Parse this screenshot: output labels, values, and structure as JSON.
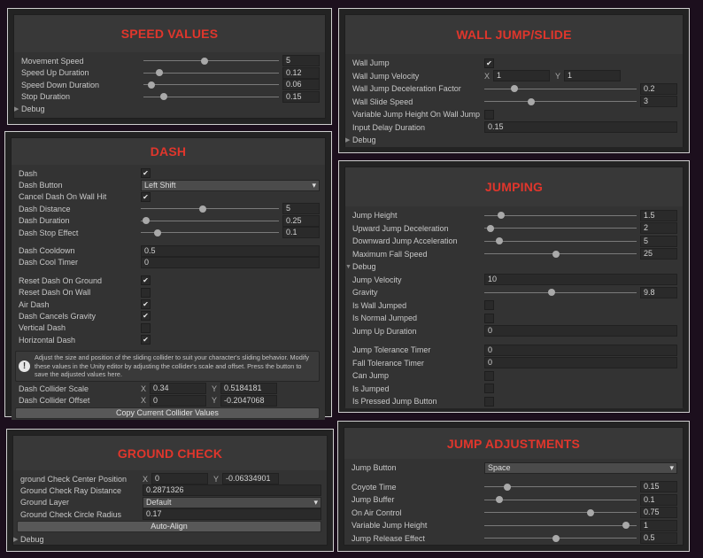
{
  "panels": {
    "speed": {
      "title": "SPEED VALUES",
      "groups": [
        [
          {
            "type": "slider",
            "label": "Movement Speed",
            "value": "5",
            "fraction": 0.45
          },
          {
            "type": "slider",
            "label": "Speed Up Duration",
            "value": "0.12",
            "fraction": 0.12
          },
          {
            "type": "slider",
            "label": "Speed Down Duration",
            "value": "0.06",
            "fraction": 0.06
          },
          {
            "type": "slider",
            "label": "Stop Duration",
            "value": "0.15",
            "fraction": 0.15
          },
          {
            "type": "foldout",
            "label": "Debug"
          }
        ]
      ]
    },
    "wall": {
      "title": "WALL JUMP/SLIDE",
      "groups": [
        [
          {
            "type": "check",
            "label": "Wall Jump",
            "checked": true
          },
          {
            "type": "vec2",
            "label": "Wall Jump Velocity",
            "x_label": "X",
            "x": "1",
            "y_label": "Y",
            "y": "1"
          },
          {
            "type": "slider",
            "label": "Wall Jump Deceleration Factor",
            "value": "0.2",
            "fraction": 0.2
          },
          {
            "type": "slider",
            "label": "Wall Slide Speed",
            "value": "3",
            "fraction": 0.31
          },
          {
            "type": "check",
            "label": "Variable Jump Height On Wall Jump",
            "checked": false
          },
          {
            "type": "float",
            "label": "Input Delay Duration",
            "value": "0.15"
          },
          {
            "type": "foldout",
            "label": "Debug"
          }
        ]
      ]
    },
    "dash": {
      "title": "DASH",
      "groups": [
        [
          {
            "type": "check",
            "label": "Dash",
            "checked": true
          },
          {
            "type": "dropdown",
            "label": "Dash Button",
            "value": "Left Shift"
          },
          {
            "type": "check",
            "label": "Cancel Dash On Wall Hit",
            "checked": true
          },
          {
            "type": "slider",
            "label": "Dash Distance",
            "value": "5",
            "fraction": 0.45
          },
          {
            "type": "slider",
            "label": "Dash Duration",
            "value": "0.25",
            "fraction": 0.04
          },
          {
            "type": "slider",
            "label": "Dash Stop Effect",
            "value": "0.1",
            "fraction": 0.12
          }
        ],
        [
          {
            "type": "float",
            "label": "Dash Cooldown",
            "value": "0.5"
          },
          {
            "type": "float",
            "label": "Dash Cool Timer",
            "value": "0"
          }
        ],
        [
          {
            "type": "check",
            "label": "Reset Dash On Ground",
            "checked": true
          },
          {
            "type": "check",
            "label": "Reset Dash On Wall",
            "checked": false
          },
          {
            "type": "check",
            "label": "Air Dash",
            "checked": true
          },
          {
            "type": "check",
            "label": "Dash Cancels Gravity",
            "checked": true
          },
          {
            "type": "check",
            "label": "Vertical Dash",
            "checked": false
          },
          {
            "type": "check",
            "label": "Horizontal Dash",
            "checked": true
          },
          {
            "type": "help",
            "label": "Adjust the size and position of the sliding collider to suit your character's sliding behavior. Modify these values in the Unity editor by adjusting the collider's scale and offset. Press the button to save the adjusted values here."
          },
          {
            "type": "vec2",
            "label": "Dash Collider Scale",
            "x_label": "X",
            "x": "0.34",
            "y_label": "Y",
            "y": "0.5184181"
          },
          {
            "type": "vec2",
            "label": "Dash Collider Offset",
            "x_label": "X",
            "x": "0",
            "y_label": "Y",
            "y": "-0.2047068"
          },
          {
            "type": "button",
            "label": "Copy Current Collider Values"
          }
        ]
      ]
    },
    "jumping": {
      "title": "JUMPING",
      "groups": [
        [
          {
            "type": "slider",
            "label": "Jump Height",
            "value": "1.5",
            "fraction": 0.11
          },
          {
            "type": "slider",
            "label": "Upward Jump Deceleration",
            "value": "2",
            "fraction": 0.04
          },
          {
            "type": "slider",
            "label": "Downward Jump Acceleration",
            "value": "5",
            "fraction": 0.1
          },
          {
            "type": "slider",
            "label": "Maximum Fall Speed",
            "value": "25",
            "fraction": 0.47
          },
          {
            "type": "foldout",
            "label": "Debug",
            "open": true
          },
          {
            "type": "float",
            "label": "Jump Velocity",
            "value": "10"
          },
          {
            "type": "slider",
            "label": "Gravity",
            "value": "9.8",
            "fraction": 0.44
          },
          {
            "type": "check",
            "label": "Is Wall Jumped",
            "checked": false
          },
          {
            "type": "check",
            "label": "Is Normal Jumped",
            "checked": false
          },
          {
            "type": "float",
            "label": "Jump Up Duration",
            "value": "0"
          }
        ],
        [
          {
            "type": "float",
            "label": "Jump Tolerance Timer",
            "value": "0"
          },
          {
            "type": "float",
            "label": "Fall Tolerance Timer",
            "value": "0"
          },
          {
            "type": "check",
            "label": "Can Jump",
            "checked": false
          },
          {
            "type": "check",
            "label": "Is Jumped",
            "checked": false
          },
          {
            "type": "check",
            "label": "Is Pressed Jump Button",
            "checked": false
          }
        ]
      ]
    },
    "ground": {
      "title": "GROUND CHECK",
      "groups": [
        [
          {
            "type": "vec2",
            "label": "ground Check Center Position",
            "x_label": "X",
            "x": "0",
            "y_label": "Y",
            "y": "-0.06334901"
          },
          {
            "type": "float",
            "label": "Ground Check Ray Distance",
            "value": "0.2871326"
          },
          {
            "type": "dropdown",
            "label": "Ground Layer",
            "value": "Default"
          },
          {
            "type": "float",
            "label": "Ground Check Circle Radius",
            "value": "0.17"
          },
          {
            "type": "button",
            "label": "Auto-Align"
          },
          {
            "type": "foldout",
            "label": "Debug"
          }
        ]
      ]
    },
    "adjust": {
      "title": "JUMP ADJUSTMENTS",
      "groups": [
        [
          {
            "type": "dropdown",
            "label": "Jump Button",
            "value": "Space"
          }
        ],
        [
          {
            "type": "slider",
            "label": "Coyote Time",
            "value": "0.15",
            "fraction": 0.15
          },
          {
            "type": "slider",
            "label": "Jump Buffer",
            "value": "0.1",
            "fraction": 0.1
          },
          {
            "type": "slider",
            "label": "On Air Control",
            "value": "0.75",
            "fraction": 0.7
          },
          {
            "type": "slider",
            "label": "Variable Jump Height",
            "value": "1",
            "fraction": 0.93
          },
          {
            "type": "slider",
            "label": "Jump Release Effect",
            "value": "0.5",
            "fraction": 0.47
          }
        ]
      ]
    }
  },
  "colors": {
    "title": "#e0362c",
    "background": "#1c0f1d"
  }
}
